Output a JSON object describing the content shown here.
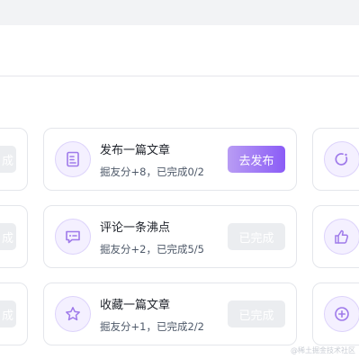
{
  "tasks": [
    {
      "title": "发布一篇文章",
      "desc": "掘友分+8，已完成0/2",
      "button": "去发布",
      "button_state": "primary",
      "icon": "document-icon"
    },
    {
      "title": "评论一条沸点",
      "desc": "掘友分+2，已完成5/5",
      "button": "已完成",
      "button_state": "done",
      "icon": "comment-icon"
    },
    {
      "title": "收藏一篇文章",
      "desc": "掘友分+1，已完成2/2",
      "button": "已完成",
      "button_state": "done",
      "icon": "star-icon"
    }
  ],
  "left_column": {
    "button_char": "成"
  },
  "right_column": {
    "icons": [
      "refresh-icon",
      "thumbs-up-icon",
      "add-circle-icon"
    ]
  },
  "watermark": "@稀土掘金技术社区",
  "colors": {
    "accent": "#8b5cf6",
    "accent_light": "#b89cf4",
    "icon_bg": "#f4f0ff",
    "border": "#e4e6eb",
    "done_bg": "#ebedf0"
  }
}
